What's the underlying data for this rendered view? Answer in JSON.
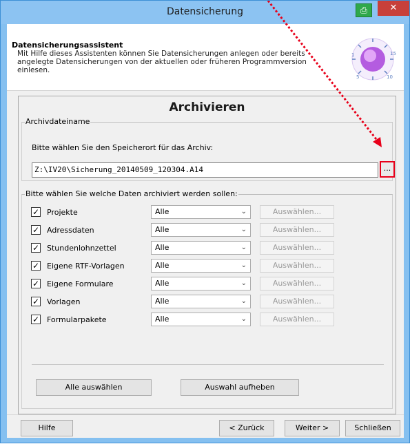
{
  "window": {
    "title": "Datensicherung"
  },
  "header": {
    "title": "Datensicherungsassistent",
    "description": "Mit Hilfe dieses Assistenten können Sie Datensicherungen anlegen oder bereits angelegte Datensicherungen von der aktuellen oder früheren Programmversion einlesen."
  },
  "main": {
    "heading": "Archivieren",
    "archive_group": {
      "label": "Archivdateiname",
      "prompt": "Bitte wählen Sie den Speicherort für das Archiv:",
      "path_value": "Z:\\IV20\\Sicherung_20140509_120304.A14",
      "browse_label": "..."
    },
    "data_group": {
      "label": "Bitte wählen Sie welche Daten archiviert werden sollen:",
      "rows": [
        {
          "label": "Projekte",
          "checked": true,
          "selection": "Alle",
          "pick_label": "Auswählen..."
        },
        {
          "label": "Adressdaten",
          "checked": true,
          "selection": "Alle",
          "pick_label": "Auswählen..."
        },
        {
          "label": "Stundenlohnzettel",
          "checked": true,
          "selection": "Alle",
          "pick_label": "Auswählen..."
        },
        {
          "label": "Eigene RTF-Vorlagen",
          "checked": true,
          "selection": "Alle",
          "pick_label": "Auswählen..."
        },
        {
          "label": "Eigene Formulare",
          "checked": true,
          "selection": "Alle",
          "pick_label": "Auswählen..."
        },
        {
          "label": "Vorlagen",
          "checked": true,
          "selection": "Alle",
          "pick_label": "Auswählen..."
        },
        {
          "label": "Formularpakete",
          "checked": true,
          "selection": "Alle",
          "pick_label": "Auswählen..."
        }
      ],
      "select_all_label": "Alle auswählen",
      "clear_selection_label": "Auswahl aufheben"
    }
  },
  "footer": {
    "help_label": "Hilfe",
    "back_label": "< Zurück",
    "next_label": "Weiter >",
    "close_label": "Schließen"
  },
  "colors": {
    "annotation_red": "#e8001a",
    "title_bar": "#8cc3f2"
  },
  "icons": [
    "window-help-icon",
    "window-close-icon",
    "clock-dial-icon",
    "checkbox-checked-icon",
    "chevron-down-icon"
  ]
}
